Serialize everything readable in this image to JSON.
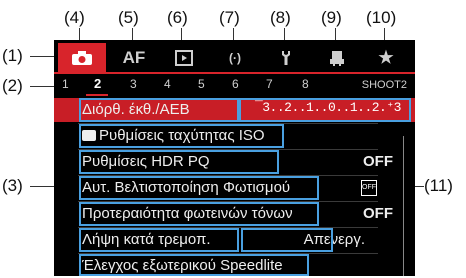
{
  "callouts": {
    "c1": "(1)",
    "c2": "(2)",
    "c3": "(3)",
    "c4": "(4)",
    "c5": "(5)",
    "c6": "(6)",
    "c7": "(7)",
    "c8": "(8)",
    "c9": "(9)",
    "c10": "(10)",
    "c11": "(11)"
  },
  "tabs": [
    {
      "name": "shooting",
      "icon": "camera-icon",
      "label": ""
    },
    {
      "name": "af",
      "icon": "",
      "label": "AF"
    },
    {
      "name": "playback",
      "icon": "playback-icon",
      "label": ""
    },
    {
      "name": "wireless",
      "icon": "wireless-icon",
      "label": "(·)"
    },
    {
      "name": "setup",
      "icon": "wrench-icon",
      "label": ""
    },
    {
      "name": "custom",
      "icon": "custom-functions-icon",
      "label": ""
    },
    {
      "name": "my-menu",
      "icon": "star-icon",
      "label": "★"
    }
  ],
  "pages": [
    "1",
    "2",
    "3",
    "4",
    "5",
    "6",
    "7",
    "8"
  ],
  "active_page": "2",
  "page_label": "SHOOT2",
  "menu": [
    {
      "label": "Διόρθ. έκθ./AEB",
      "value": "¯3..2..1..0..1..2.⁺3",
      "selected": true
    },
    {
      "label": "Ρυθμίσεις ταχύτητας ISO",
      "value": "",
      "selected": false
    },
    {
      "label": "Ρυθμίσεις HDR PQ",
      "value": "OFF",
      "selected": false
    },
    {
      "label": "Αυτ. Βελτιστοποίηση Φωτισμού",
      "value": "",
      "selected": false
    },
    {
      "label": "Προτεραιότητα φωτεινών τόνων",
      "value": "OFF",
      "selected": false
    },
    {
      "label": "Λήψη κατά τρεμοπ.",
      "value": "Απενεργ.",
      "selected": false
    },
    {
      "label": "Έλεγχος εξωτερικού Speedlite",
      "value": "",
      "selected": false
    }
  ],
  "colors": {
    "accent": "#d8242b",
    "highlight": "#4aa0e0"
  }
}
